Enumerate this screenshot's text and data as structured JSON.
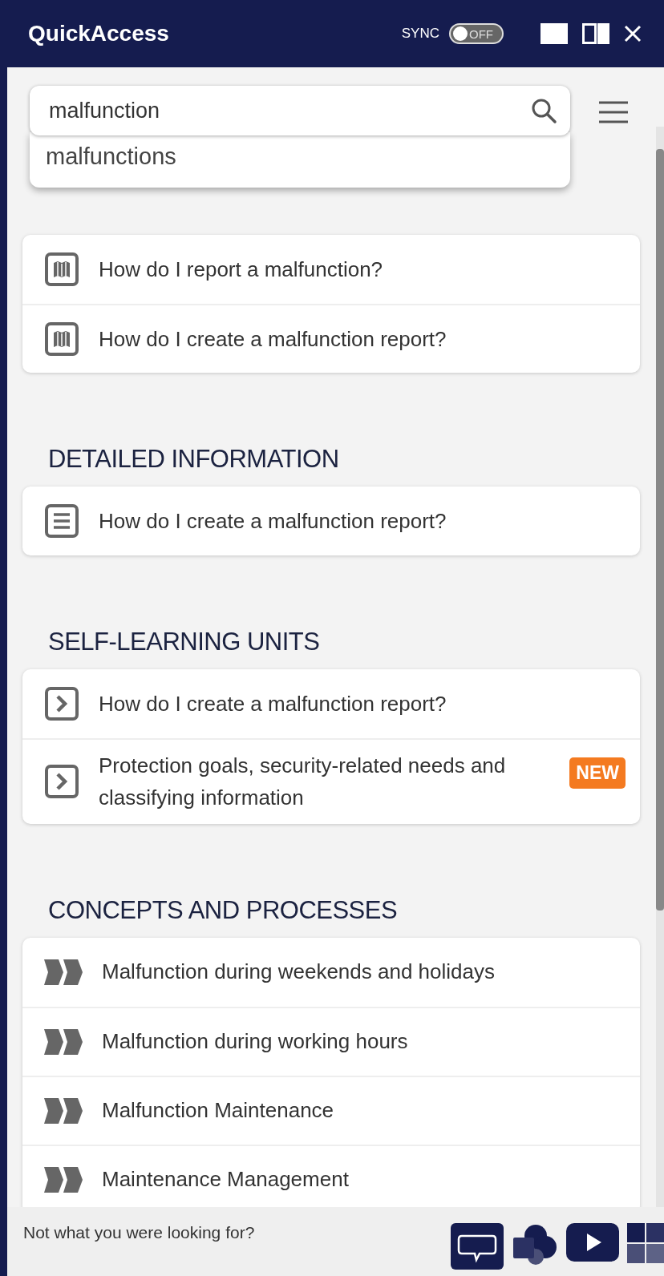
{
  "window": {
    "title": "QuickAccess"
  },
  "sync": {
    "label": "SYNC",
    "on": false,
    "state_label": "OFF"
  },
  "search": {
    "value": "malfunction"
  },
  "suggestions": [
    "malfunctions"
  ],
  "sections": [
    {
      "kind": "guide",
      "items": [
        {
          "label": "How do I report a malfunction?"
        },
        {
          "label": "How do I create a malfunction report?"
        }
      ]
    },
    {
      "title": "DETAILED INFORMATION",
      "kind": "document",
      "items": [
        {
          "label": "How do I create a malfunction report?"
        }
      ]
    },
    {
      "title": "SELF-LEARNING UNITS",
      "kind": "unit",
      "items": [
        {
          "label": "How do I create a malfunction report?"
        },
        {
          "label": "Protection goals, security-related needs and classifying information",
          "badge": "NEW"
        }
      ]
    },
    {
      "title": "CONCEPTS AND PROCESSES",
      "kind": "process",
      "items": [
        {
          "label": "Malfunction during weekends and holidays"
        },
        {
          "label": "Malfunction during working hours"
        },
        {
          "label": "Malfunction Maintenance"
        },
        {
          "label": "Maintenance Management"
        }
      ]
    }
  ],
  "footer": {
    "prompt": "Not what you were looking for?"
  }
}
